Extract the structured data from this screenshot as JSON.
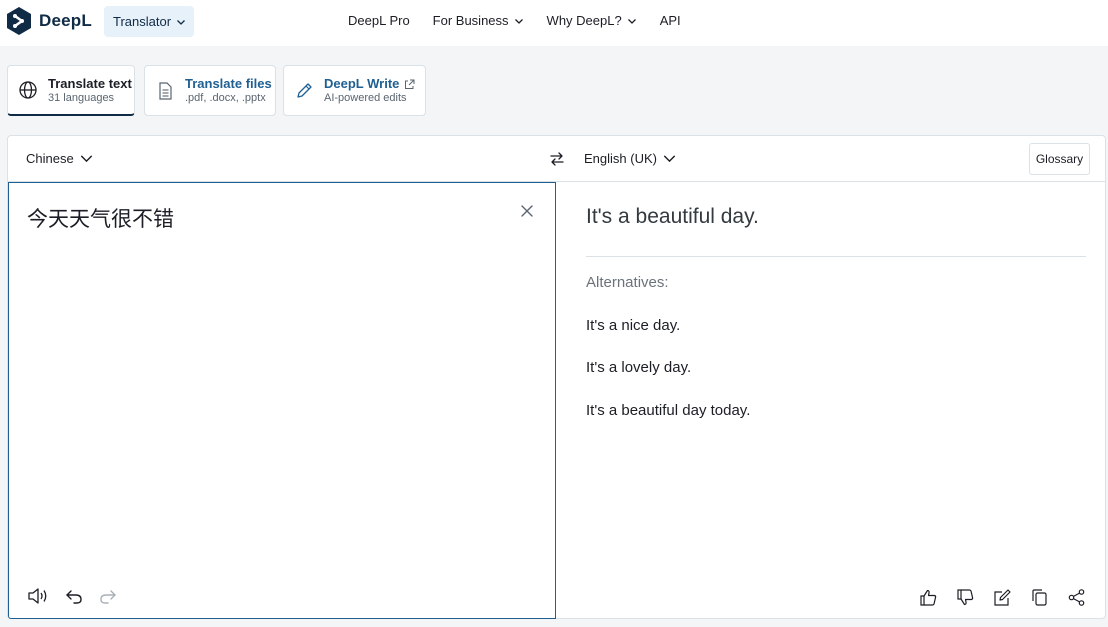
{
  "header": {
    "brand": "DeepL",
    "product_menu": "Translator",
    "nav": [
      "DeepL Pro",
      "For Business",
      "Why DeepL?",
      "API"
    ]
  },
  "tabs": [
    {
      "label": "Translate text",
      "sub": "31 languages",
      "icon": "globe-icon"
    },
    {
      "label": "Translate files",
      "sub": ".pdf, .docx, .pptx",
      "icon": "document-icon"
    },
    {
      "label": "DeepL Write",
      "sub": "AI-powered edits",
      "icon": "pencil-icon"
    }
  ],
  "translator": {
    "source_language": "Chinese",
    "target_language": "English (UK)",
    "glossary_label": "Glossary",
    "source_text": "今天天气很不错",
    "translation": "It's a beautiful day.",
    "alternatives_title": "Alternatives:",
    "alternatives": [
      "It's a nice day.",
      "It's a lovely day.",
      "It's a beautiful day today."
    ]
  },
  "colors": {
    "brand_navy": "#0f2b46",
    "accent_blue": "#1f5f92",
    "pill_bg": "#e7f1f9",
    "page_bg": "#f3f5f6"
  }
}
